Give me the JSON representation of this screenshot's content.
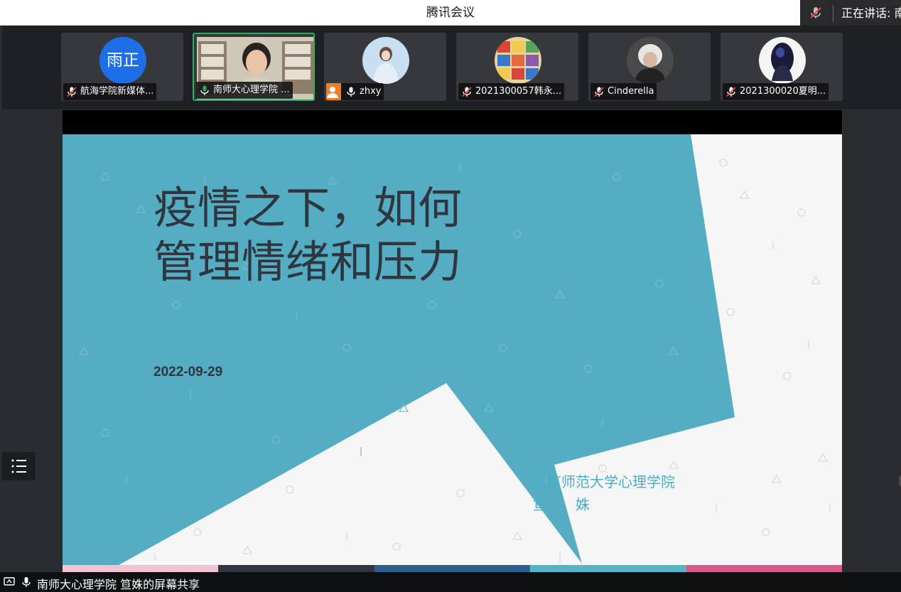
{
  "window": {
    "title": "腾讯会议"
  },
  "speaking": {
    "label": "正在讲话: 南"
  },
  "participants": [
    {
      "name": "航海学院新媒体...",
      "avatar_text": "雨正",
      "mic": "muted"
    },
    {
      "name": "南师大心理学院 ...",
      "mic": "on",
      "video": true
    },
    {
      "name": "zhxy",
      "mic": "on"
    },
    {
      "name": "2021300057韩永...",
      "mic": "muted"
    },
    {
      "name": "Cinderella",
      "mic": "muted"
    },
    {
      "name": "2021300020夏明...",
      "mic": "muted"
    }
  ],
  "slide": {
    "title_line1": "疫情之下，如何",
    "title_line2": "管理情绪和压力",
    "date": "2022-09-29",
    "institution": "南京师范大学心理学院",
    "presenter": "笪　　姝"
  },
  "status": {
    "share_text": "南师大心理学院 笪姝的屏幕共享"
  },
  "colors": {
    "accent_teal": "#55adc3",
    "active_border": "#27b05c",
    "bar_colors": [
      "#f2c3d2",
      "#2f3640",
      "#2f5f8f",
      "#55b4c6",
      "#d65a8a"
    ]
  }
}
